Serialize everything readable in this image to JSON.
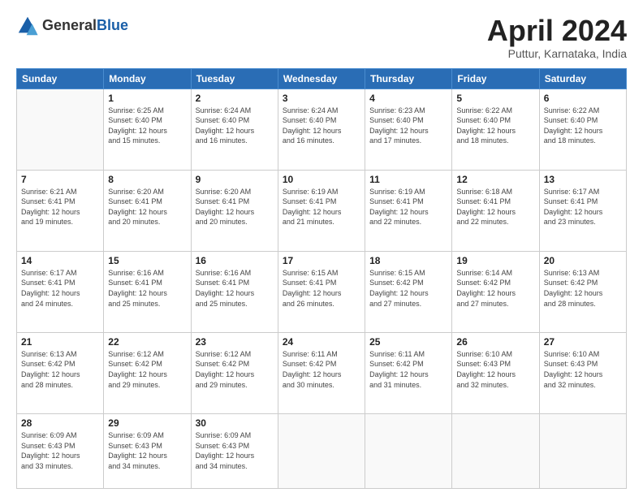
{
  "header": {
    "logo_line1": "General",
    "logo_line2": "Blue",
    "month": "April 2024",
    "location": "Puttur, Karnataka, India"
  },
  "weekdays": [
    "Sunday",
    "Monday",
    "Tuesday",
    "Wednesday",
    "Thursday",
    "Friday",
    "Saturday"
  ],
  "weeks": [
    [
      {
        "day": "",
        "empty": true
      },
      {
        "day": "1",
        "sunrise": "6:25 AM",
        "sunset": "6:40 PM",
        "daylight": "12 hours and 15 minutes."
      },
      {
        "day": "2",
        "sunrise": "6:24 AM",
        "sunset": "6:40 PM",
        "daylight": "12 hours and 16 minutes."
      },
      {
        "day": "3",
        "sunrise": "6:24 AM",
        "sunset": "6:40 PM",
        "daylight": "12 hours and 16 minutes."
      },
      {
        "day": "4",
        "sunrise": "6:23 AM",
        "sunset": "6:40 PM",
        "daylight": "12 hours and 17 minutes."
      },
      {
        "day": "5",
        "sunrise": "6:22 AM",
        "sunset": "6:40 PM",
        "daylight": "12 hours and 18 minutes."
      },
      {
        "day": "6",
        "sunrise": "6:22 AM",
        "sunset": "6:40 PM",
        "daylight": "12 hours and 18 minutes."
      }
    ],
    [
      {
        "day": "7",
        "sunrise": "6:21 AM",
        "sunset": "6:41 PM",
        "daylight": "12 hours and 19 minutes."
      },
      {
        "day": "8",
        "sunrise": "6:20 AM",
        "sunset": "6:41 PM",
        "daylight": "12 hours and 20 minutes."
      },
      {
        "day": "9",
        "sunrise": "6:20 AM",
        "sunset": "6:41 PM",
        "daylight": "12 hours and 20 minutes."
      },
      {
        "day": "10",
        "sunrise": "6:19 AM",
        "sunset": "6:41 PM",
        "daylight": "12 hours and 21 minutes."
      },
      {
        "day": "11",
        "sunrise": "6:19 AM",
        "sunset": "6:41 PM",
        "daylight": "12 hours and 22 minutes."
      },
      {
        "day": "12",
        "sunrise": "6:18 AM",
        "sunset": "6:41 PM",
        "daylight": "12 hours and 22 minutes."
      },
      {
        "day": "13",
        "sunrise": "6:17 AM",
        "sunset": "6:41 PM",
        "daylight": "12 hours and 23 minutes."
      }
    ],
    [
      {
        "day": "14",
        "sunrise": "6:17 AM",
        "sunset": "6:41 PM",
        "daylight": "12 hours and 24 minutes."
      },
      {
        "day": "15",
        "sunrise": "6:16 AM",
        "sunset": "6:41 PM",
        "daylight": "12 hours and 25 minutes."
      },
      {
        "day": "16",
        "sunrise": "6:16 AM",
        "sunset": "6:41 PM",
        "daylight": "12 hours and 25 minutes."
      },
      {
        "day": "17",
        "sunrise": "6:15 AM",
        "sunset": "6:41 PM",
        "daylight": "12 hours and 26 minutes."
      },
      {
        "day": "18",
        "sunrise": "6:15 AM",
        "sunset": "6:42 PM",
        "daylight": "12 hours and 27 minutes."
      },
      {
        "day": "19",
        "sunrise": "6:14 AM",
        "sunset": "6:42 PM",
        "daylight": "12 hours and 27 minutes."
      },
      {
        "day": "20",
        "sunrise": "6:13 AM",
        "sunset": "6:42 PM",
        "daylight": "12 hours and 28 minutes."
      }
    ],
    [
      {
        "day": "21",
        "sunrise": "6:13 AM",
        "sunset": "6:42 PM",
        "daylight": "12 hours and 28 minutes."
      },
      {
        "day": "22",
        "sunrise": "6:12 AM",
        "sunset": "6:42 PM",
        "daylight": "12 hours and 29 minutes."
      },
      {
        "day": "23",
        "sunrise": "6:12 AM",
        "sunset": "6:42 PM",
        "daylight": "12 hours and 29 minutes."
      },
      {
        "day": "24",
        "sunrise": "6:11 AM",
        "sunset": "6:42 PM",
        "daylight": "12 hours and 30 minutes."
      },
      {
        "day": "25",
        "sunrise": "6:11 AM",
        "sunset": "6:42 PM",
        "daylight": "12 hours and 31 minutes."
      },
      {
        "day": "26",
        "sunrise": "6:10 AM",
        "sunset": "6:43 PM",
        "daylight": "12 hours and 32 minutes."
      },
      {
        "day": "27",
        "sunrise": "6:10 AM",
        "sunset": "6:43 PM",
        "daylight": "12 hours and 32 minutes."
      }
    ],
    [
      {
        "day": "28",
        "sunrise": "6:09 AM",
        "sunset": "6:43 PM",
        "daylight": "12 hours and 33 minutes."
      },
      {
        "day": "29",
        "sunrise": "6:09 AM",
        "sunset": "6:43 PM",
        "daylight": "12 hours and 34 minutes."
      },
      {
        "day": "30",
        "sunrise": "6:09 AM",
        "sunset": "6:43 PM",
        "daylight": "12 hours and 34 minutes."
      },
      {
        "day": "",
        "empty": true
      },
      {
        "day": "",
        "empty": true
      },
      {
        "day": "",
        "empty": true
      },
      {
        "day": "",
        "empty": true
      }
    ]
  ]
}
